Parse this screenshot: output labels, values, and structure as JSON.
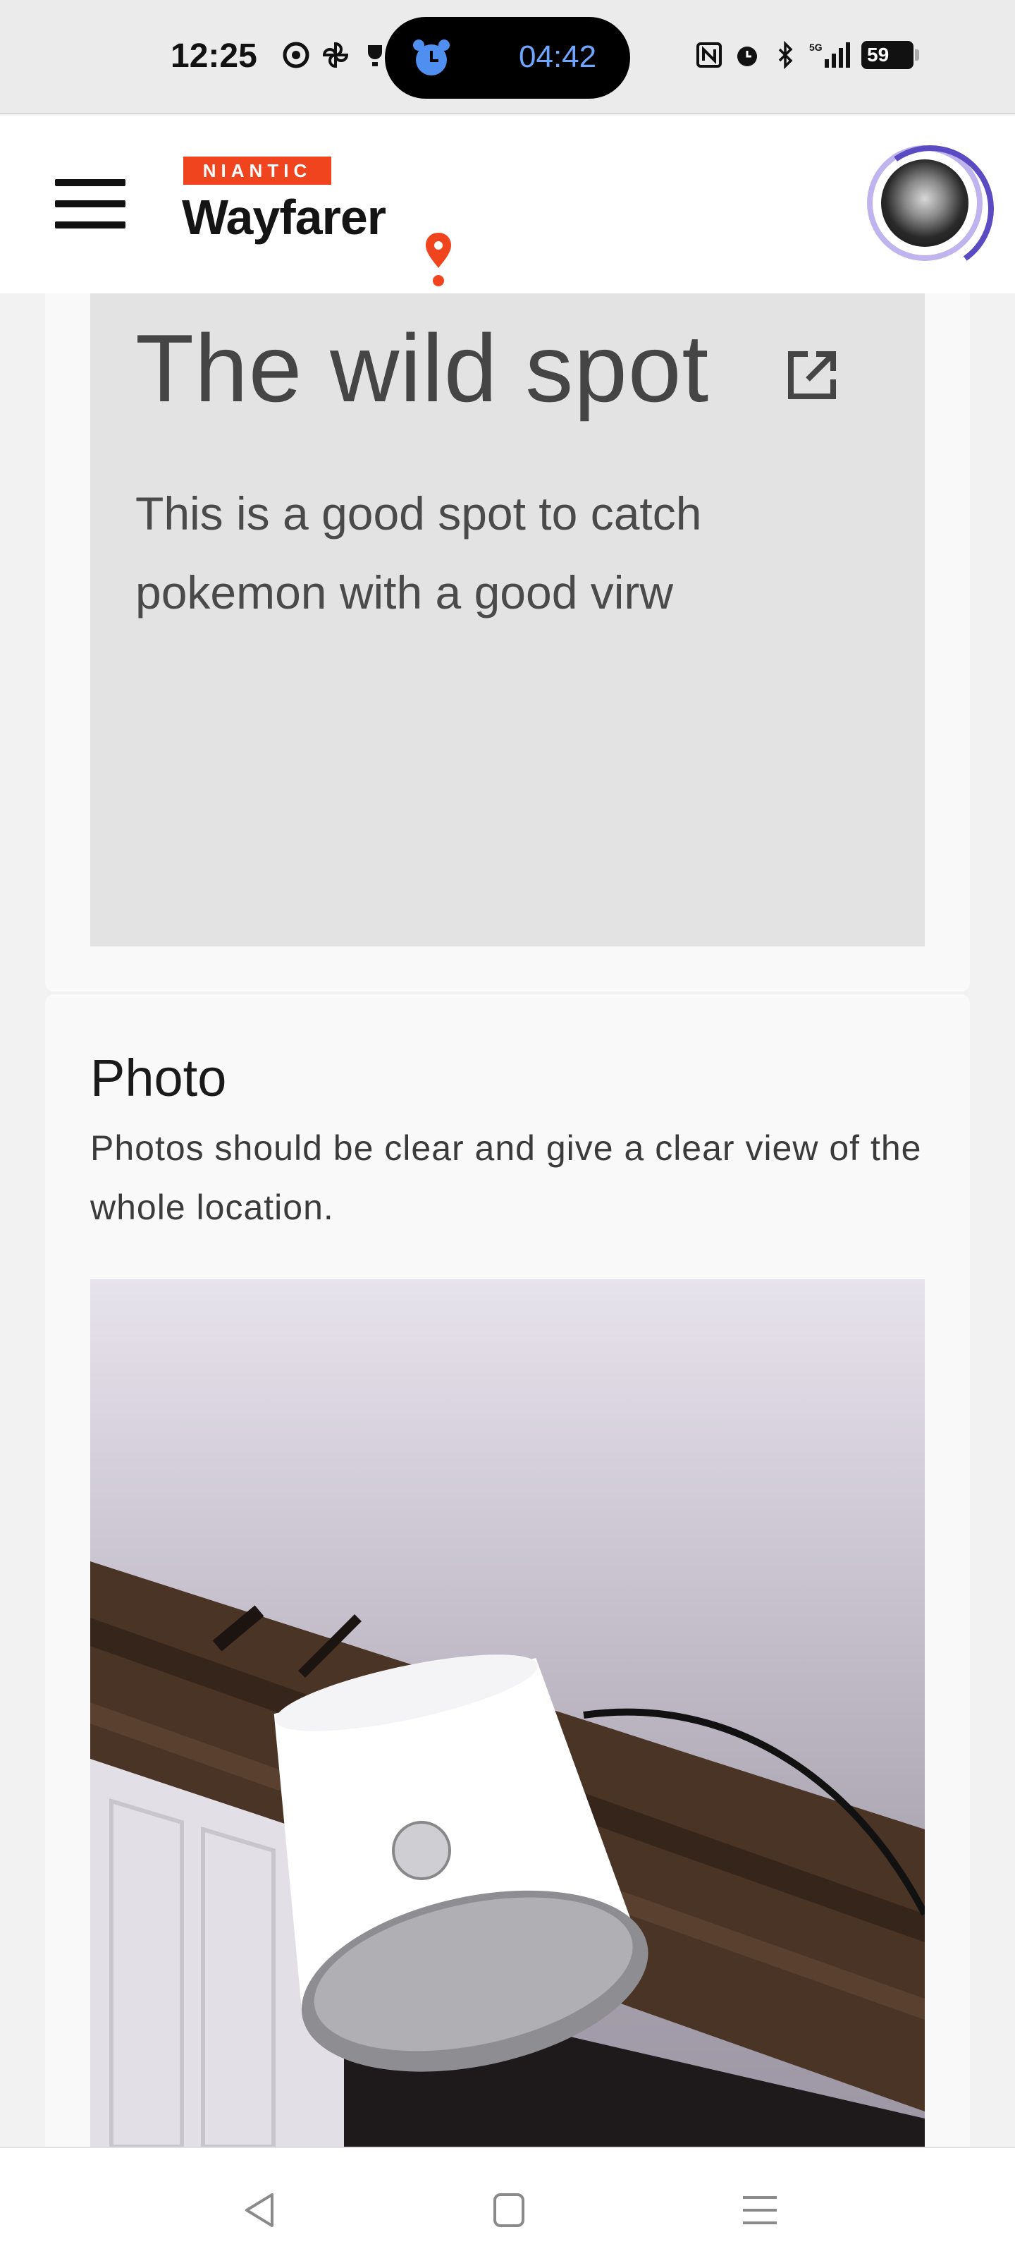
{
  "status_bar": {
    "time": "12:25",
    "timer": "04:42",
    "battery": "59",
    "network": "5G",
    "left_icons": [
      "chrome-icon",
      "pinwheel-icon",
      "trophy-icon"
    ],
    "right_icons": [
      "nfc-icon",
      "alarm-icon",
      "bluetooth-icon",
      "signal-icon"
    ]
  },
  "header": {
    "brand_tag": "NIANTIC",
    "brand_name": "Wayfarer",
    "accent_color": "#f0441f",
    "avatar_ring_color": "#5b4bc2"
  },
  "nomination": {
    "title": "The wild spot",
    "description": "This is a good spot to catch pokemon with a good virw"
  },
  "photo_section": {
    "heading": "Photo",
    "subtext": "Photos should be clear and give a clear view of the whole location."
  },
  "nav_bar": {
    "items": [
      "back-icon",
      "home-icon",
      "recents-icon"
    ]
  }
}
